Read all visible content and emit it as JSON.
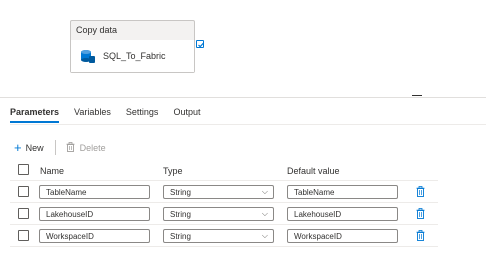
{
  "activity": {
    "header": "Copy data",
    "name": "SQL_To_Fabric"
  },
  "tabs": [
    {
      "label": "Parameters",
      "active": true
    },
    {
      "label": "Variables",
      "active": false
    },
    {
      "label": "Settings",
      "active": false
    },
    {
      "label": "Output",
      "active": false
    }
  ],
  "toolbar": {
    "new_label": "New",
    "delete_label": "Delete"
  },
  "table": {
    "headers": {
      "name": "Name",
      "type": "Type",
      "default": "Default value"
    },
    "rows": [
      {
        "name": "TableName",
        "type": "String",
        "default": "TableName"
      },
      {
        "name": "LakehouseID",
        "type": "String",
        "default": "LakehouseID"
      },
      {
        "name": "WorkspaceID",
        "type": "String",
        "default": "WorkspaceID"
      }
    ]
  },
  "colors": {
    "accent": "#0078d4",
    "border": "#8a8886",
    "text": "#323130",
    "disabled": "#a19f9d"
  },
  "icons": {
    "activity": "copy-data-icon",
    "check": "check-icon",
    "add": "plus-icon",
    "delete": "trash-icon",
    "dropdown": "chevron-down-icon"
  }
}
